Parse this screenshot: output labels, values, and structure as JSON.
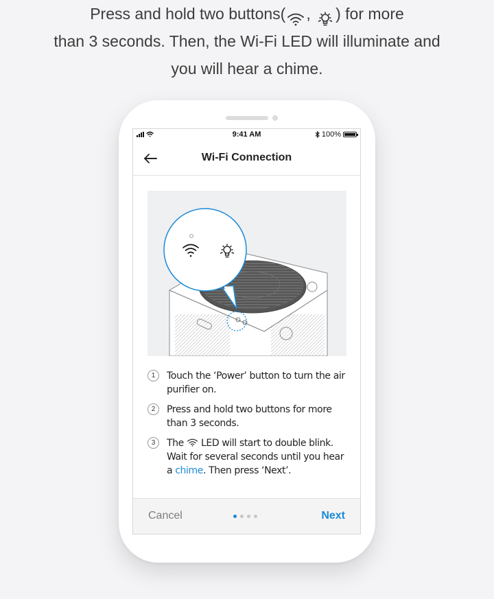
{
  "instruction": {
    "line1_prefix": "Press and hold two buttons(",
    "line1_separator": ",",
    "line1_suffix": ") for more",
    "line2": "than 3 seconds. Then, the Wi-Fi LED will illuminate and",
    "line3": "you will hear a chime.",
    "icons": [
      "wifi-icon",
      "lamp-icon"
    ]
  },
  "status_bar": {
    "time": "9:41 AM",
    "battery_text": "100%"
  },
  "nav": {
    "title": "Wi-Fi Connection",
    "back_icon": "arrow-left-icon"
  },
  "steps": [
    {
      "number": "1",
      "text": "Touch the ‘Power’ button to turn the air purifier on."
    },
    {
      "number": "2",
      "text": "Press and hold two buttons for more than 3 seconds."
    },
    {
      "number": "3",
      "text_before": "The",
      "text_middle": "LED will start to double blink. Wait for several seconds until you hear a",
      "link": "chime",
      "text_after": ". Then press ‘Next’."
    }
  ],
  "footer": {
    "cancel_label": "Cancel",
    "next_label": "Next",
    "page_count": 4,
    "current_page": 1
  },
  "colors": {
    "accent": "#1a8ad6",
    "text": "#222222",
    "muted": "#7d7d7d"
  }
}
